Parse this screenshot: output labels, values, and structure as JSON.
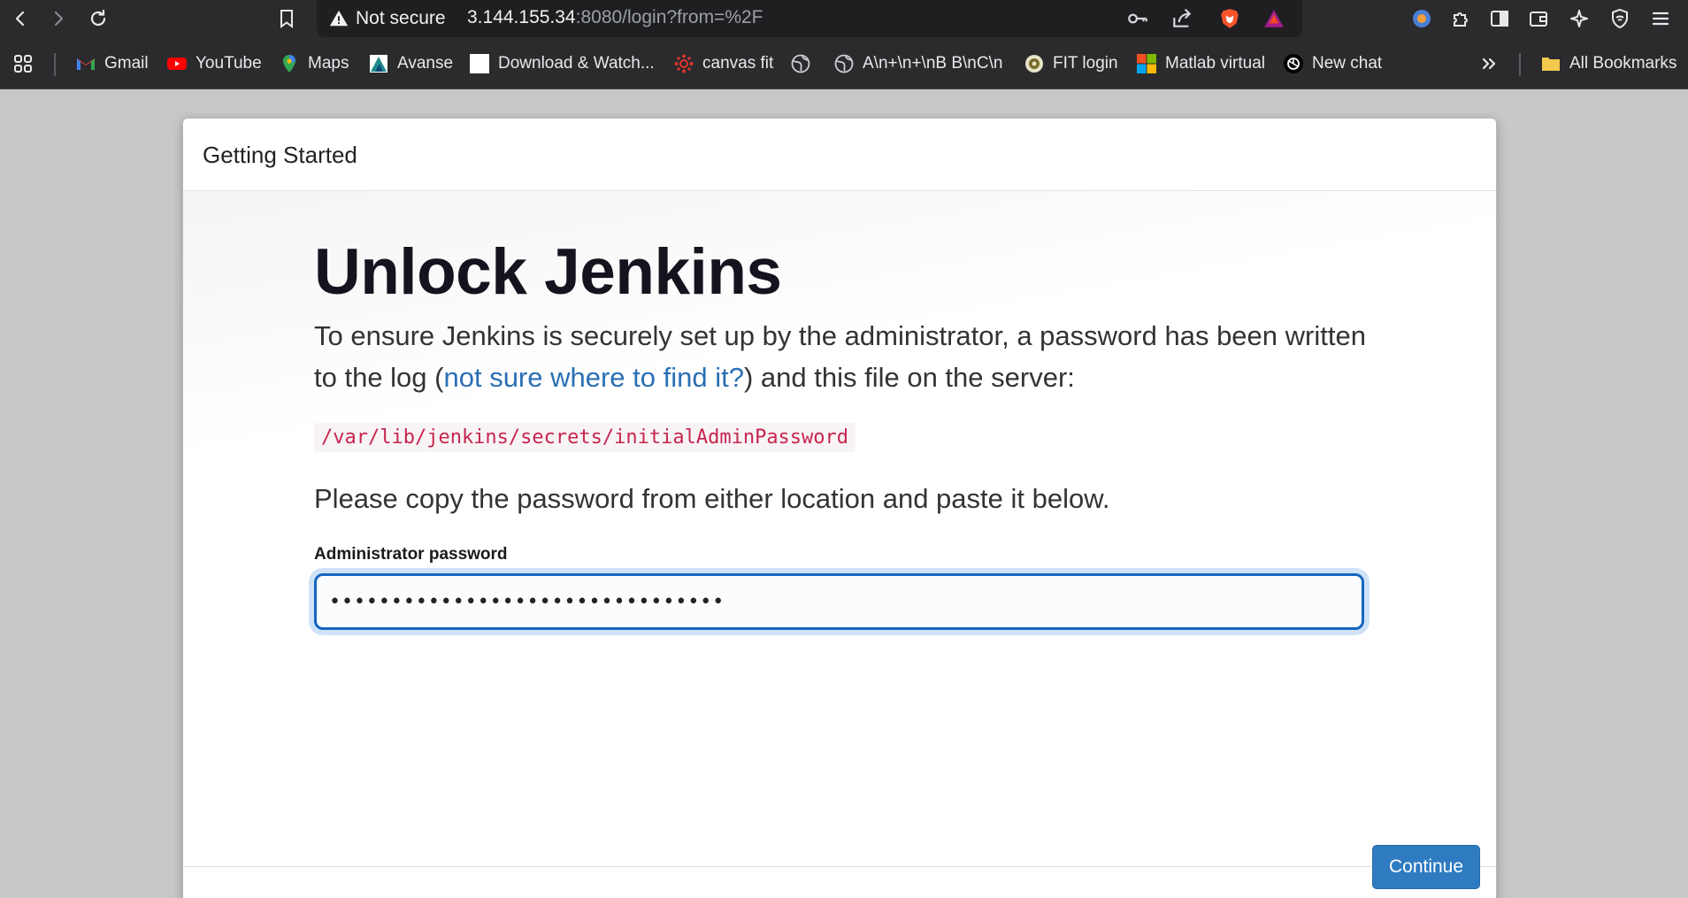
{
  "browser": {
    "security_label": "Not secure",
    "url_host": "3.144.155.34",
    "url_rest": ":8080/login?from=%2F"
  },
  "bookmarks": [
    {
      "label": "Gmail",
      "icon": "gmail-icon"
    },
    {
      "label": "YouTube",
      "icon": "youtube-icon"
    },
    {
      "label": "Maps",
      "icon": "maps-icon"
    },
    {
      "label": "Avanse",
      "icon": "avanse-icon"
    },
    {
      "label": "Download & Watch...",
      "icon": "page-icon"
    },
    {
      "label": "canvas fit",
      "icon": "canvas-icon"
    },
    {
      "label": "",
      "icon": "globe-icon"
    },
    {
      "label": "A\\n+\\n+\\nB B\\nC\\n",
      "icon": "globe-icon"
    },
    {
      "label": "FIT login",
      "icon": "fit-icon"
    },
    {
      "label": "Matlab virtual",
      "icon": "microsoft-icon"
    },
    {
      "label": "New chat",
      "icon": "openai-icon"
    }
  ],
  "all_bookmarks": "All Bookmarks",
  "dialog": {
    "header_title": "Getting Started",
    "headline": "Unlock Jenkins",
    "intro_before": "To ensure Jenkins is securely set up by the administrator, a password has been written to the log (",
    "intro_link": "not sure where to find it?",
    "intro_after": ") and this file on the server:",
    "file_path": "/var/lib/jenkins/secrets/initialAdminPassword",
    "instruction": "Please copy the password from either location and paste it below.",
    "password_label": "Administrator password",
    "password_value": "••••••••••••••••••••••••••••••••",
    "continue_label": "Continue"
  },
  "colors": {
    "link": "#2a6fb5",
    "code_text": "#c7254e",
    "button": "#2e7bc1",
    "focus_border": "#1565c0"
  }
}
